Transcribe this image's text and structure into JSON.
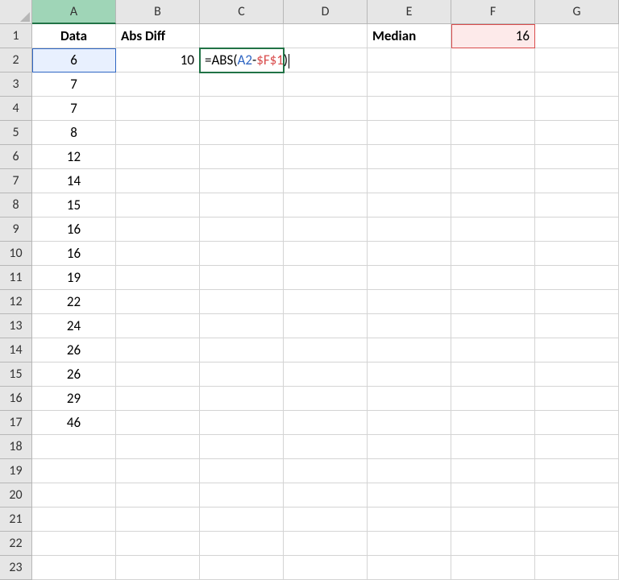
{
  "columns": [
    "A",
    "B",
    "C",
    "D",
    "E",
    "F",
    "G"
  ],
  "row_count": 23,
  "selected_column": "A",
  "headers": {
    "A1": "Data",
    "B1": "Abs Diff",
    "E1": "Median"
  },
  "values": {
    "F1": "16",
    "B2": "10",
    "A2": "6",
    "A3": "7",
    "A4": "7",
    "A5": "8",
    "A6": "12",
    "A7": "14",
    "A8": "15",
    "A9": "16",
    "A10": "16",
    "A11": "19",
    "A12": "22",
    "A13": "24",
    "A14": "26",
    "A15": "26",
    "A16": "29",
    "A17": "46"
  },
  "editing_cell": {
    "address": "C2",
    "formula_parts": {
      "prefix": "=ABS(",
      "ref1": "A2",
      "mid": "-",
      "ref2": "$F$1",
      "suffix": ")"
    }
  },
  "referenced_cells": [
    "A2",
    "F1"
  ]
}
